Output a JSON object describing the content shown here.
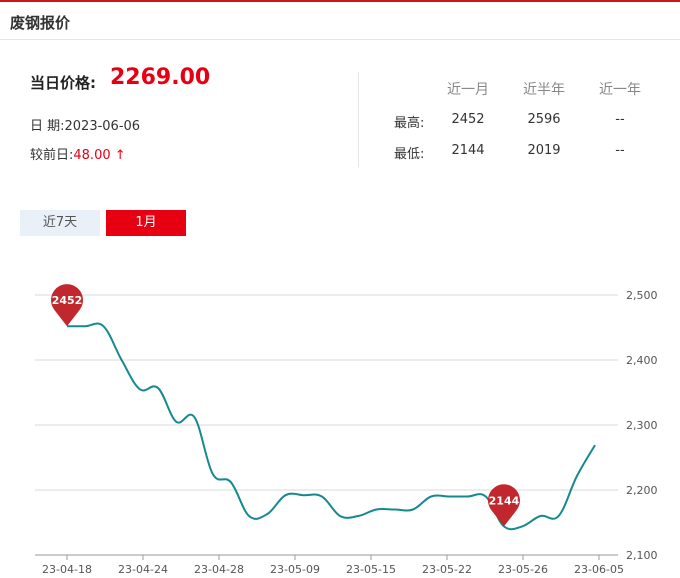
{
  "header": {
    "title": "废钢报价"
  },
  "summary": {
    "price_label": "当日价格:",
    "price_value": "2269.00",
    "date_label": "日 期:",
    "date_value": "2023-06-06",
    "change_label": "较前日:",
    "change_value": "48.00 ↑"
  },
  "stats": {
    "columns": [
      "近一月",
      "近半年",
      "近一年"
    ],
    "rows": [
      {
        "label": "最高:",
        "values": [
          "2452",
          "2596",
          "--"
        ]
      },
      {
        "label": "最低:",
        "values": [
          "2144",
          "2019",
          "--"
        ]
      }
    ]
  },
  "tabs": [
    {
      "label": "近7天",
      "active": false
    },
    {
      "label": "1月",
      "active": true
    }
  ],
  "colors": {
    "accent": "#e60012",
    "line": "#16898f",
    "marker": "#c0282d"
  },
  "chart_data": {
    "type": "line",
    "x_ticks": [
      "23-04-18",
      "23-04-24",
      "23-04-28",
      "23-05-09",
      "23-05-15",
      "23-05-22",
      "23-05-26",
      "23-06-05"
    ],
    "y_ticks": [
      "2,100",
      "2,200",
      "2,300",
      "2,400",
      "2,500"
    ],
    "ylim": [
      2100,
      2500
    ],
    "y_axis_side": "right",
    "grid": true,
    "series": [
      {
        "values": [
          2452,
          2452,
          2452,
          2400,
          2355,
          2357,
          2305,
          2312,
          2225,
          2212,
          2160,
          2163,
          2192,
          2192,
          2190,
          2160,
          2160,
          2170,
          2170,
          2170,
          2190,
          2190,
          2190,
          2190,
          2144,
          2144,
          2160,
          2160,
          2221,
          2269
        ]
      }
    ],
    "annotations": [
      {
        "label": "2452",
        "index": 0,
        "value": 2452
      },
      {
        "label": "2144",
        "index": 24,
        "value": 2144
      }
    ]
  }
}
